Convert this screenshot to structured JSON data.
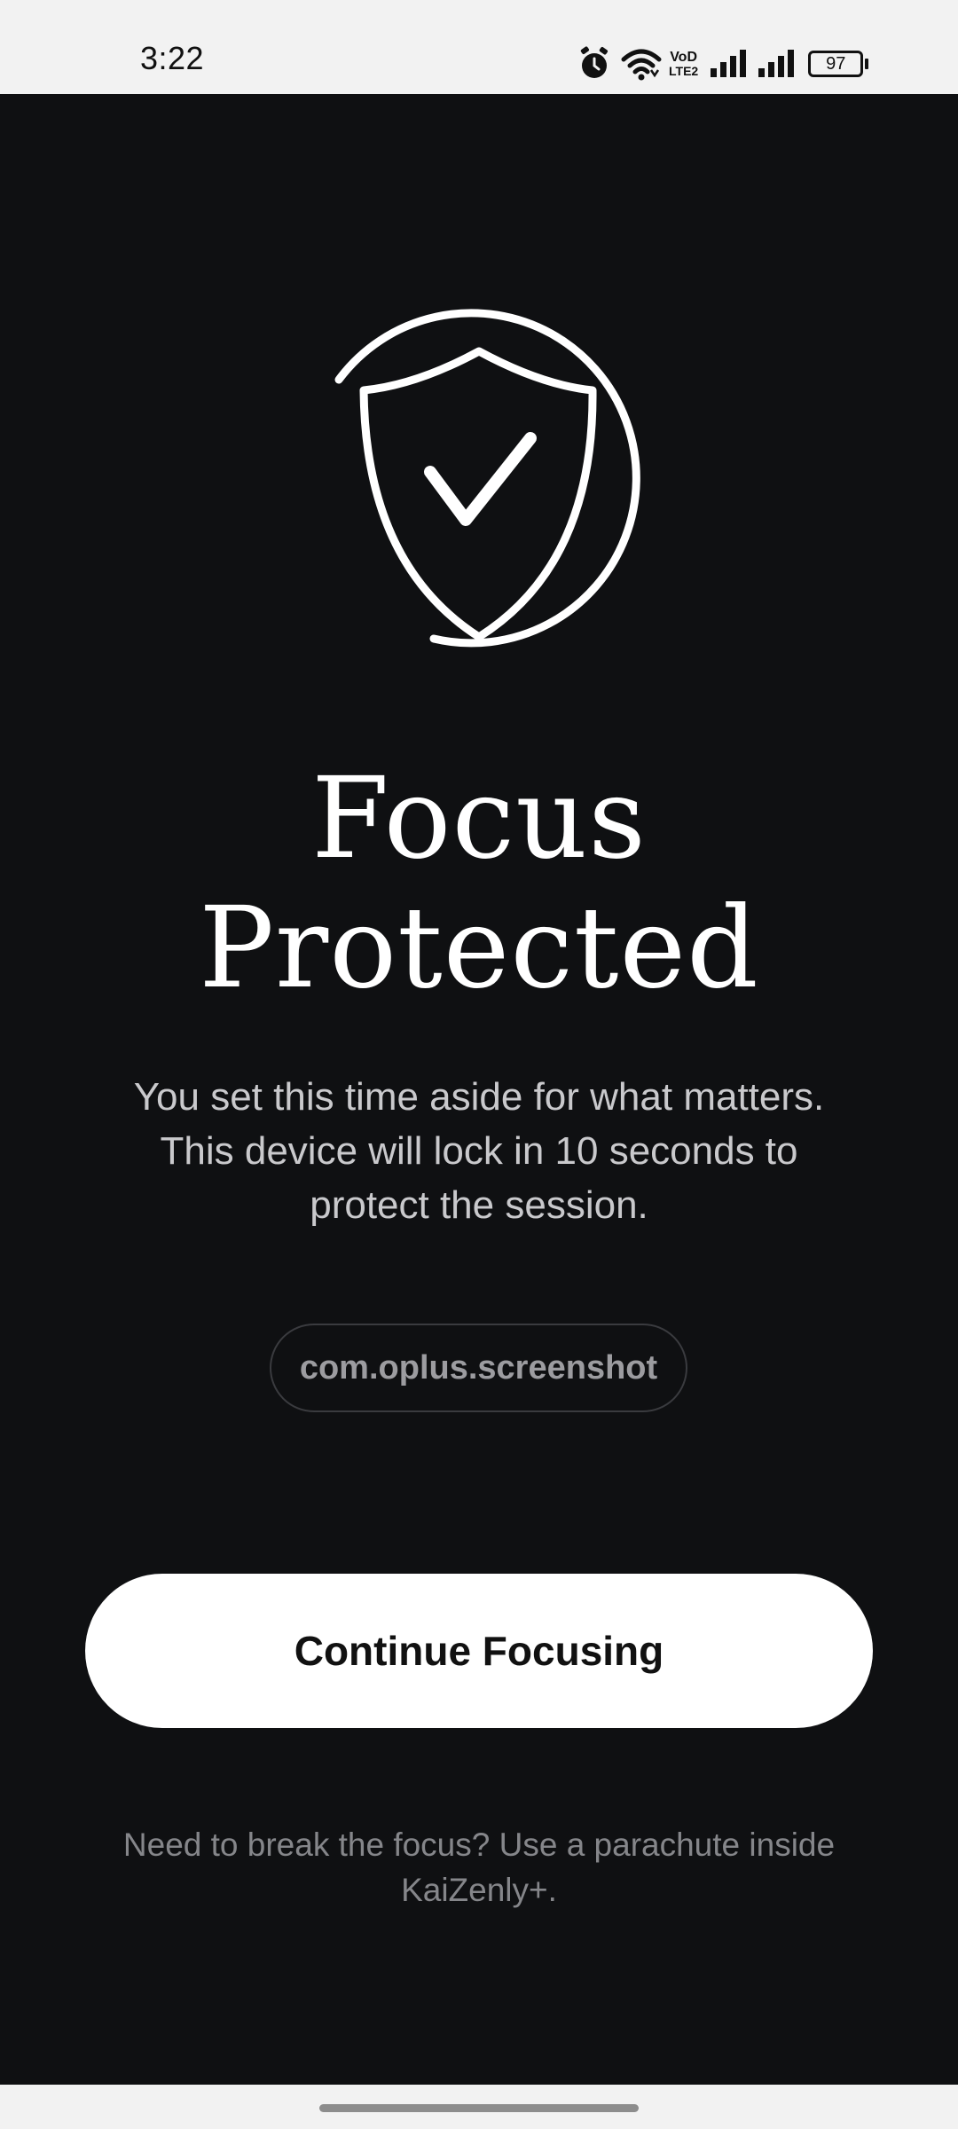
{
  "status_bar": {
    "time": "3:22",
    "battery": "97",
    "network_badge_top": "VoD",
    "network_badge_bottom": "LTE2",
    "icons": [
      "alarm-icon",
      "wifi-icon",
      "volte-icon",
      "signal-icon",
      "signal-icon",
      "battery-icon"
    ]
  },
  "hero": {
    "icon": "shield-check-icon"
  },
  "title_line1": "Focus",
  "title_line2": "Protected",
  "subtitle_line1": "You set this time aside for what matters.",
  "subtitle_line2": "This device will lock in 10 seconds to",
  "subtitle_line3": "protect the session.",
  "package_name": "com.oplus.screenshot",
  "primary_button_label": "Continue Focusing",
  "footer_line1": "Need to break the focus? Use a parachute inside",
  "footer_line2": "KaiZenly+.",
  "colors": {
    "background": "#0f1012",
    "status_bar": "#f2f2f2",
    "button": "#ffffff",
    "chip_border": "#3a3b3f"
  }
}
